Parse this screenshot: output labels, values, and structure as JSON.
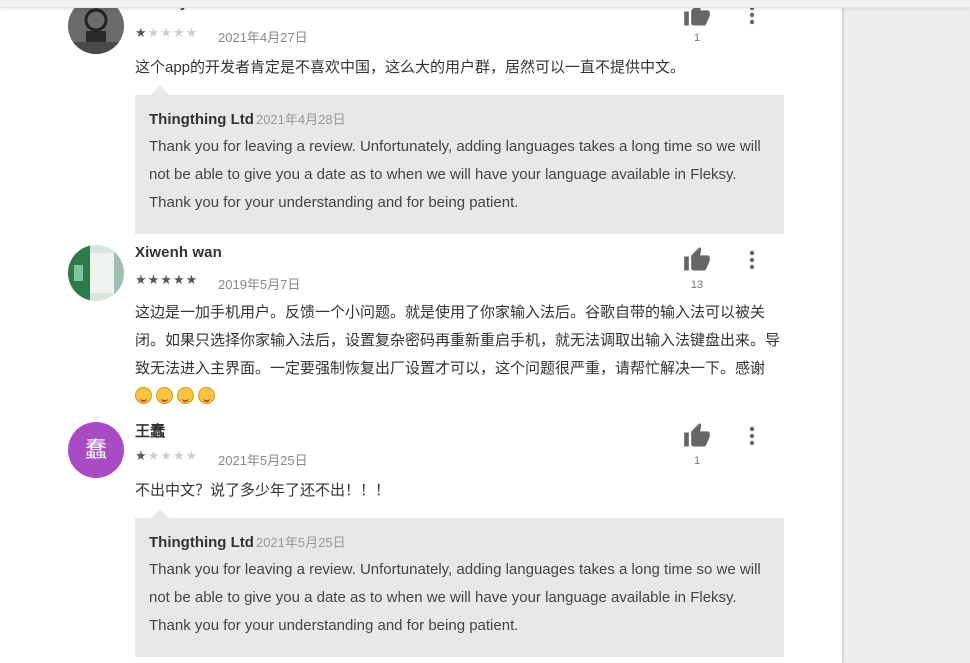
{
  "reviews": [
    {
      "name": "ethan yan",
      "rating": 1,
      "date": "2021年4月27日",
      "likes": "1",
      "text": "这个app的开发者肯定是不喜欢中国，这么大的用户群，居然可以一直不提供中文。",
      "reply": {
        "developer": "Thingthing Ltd",
        "date": "2021年4月28日",
        "text": "Thank you for leaving a review. Unfortunately, adding languages takes a long time so we will not be able to give you a date as to when we will have your language available in Fleksy. Thank you for your understanding and for being patient."
      }
    },
    {
      "name": "Xiwenh wan",
      "rating": 5,
      "date": "2019年5月7日",
      "likes": "13",
      "text": "这边是一加手机用户。反馈一个小问题。就是使用了你家输入法后。谷歌自带的输入法可以被关闭。如果只选择你家输入法后，设置复杂密码再重新重启手机，就无法调取出输入法键盘出来。导致无法进入主界面。一定要强制恢复出厂设置才可以，这个问题很严重，请帮忙解决一下。感谢"
    },
    {
      "name": "王蠢",
      "avatar_letter": "蠢",
      "avatar_color": "#a94bc4",
      "rating": 1,
      "date": "2021年5月25日",
      "likes": "1",
      "text": "不出中文？说了多少年了还不出！！！",
      "reply": {
        "developer": "Thingthing Ltd",
        "date": "2021年5月25日",
        "text": "Thank you for leaving a review. Unfortunately, adding languages takes a long time so we will not be able to give you a date as to when we will have your language available in Fleksy. Thank you for your understanding and for being patient."
      }
    }
  ],
  "icons": {
    "like": "thumb-up-icon",
    "more": "more-vert-icon",
    "star": "star-icon"
  },
  "colors": {
    "reply_bg": "#e8e8e8",
    "icon": "#666666"
  }
}
